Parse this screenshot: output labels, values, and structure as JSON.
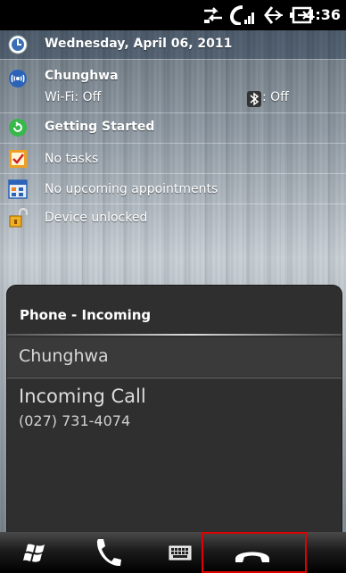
{
  "status_bar": {
    "time": "4:36",
    "icons": [
      "data-sync-icon",
      "signal-icon",
      "volume-icon",
      "battery-charging-icon"
    ]
  },
  "today": {
    "date": "Wednesday, April 06, 2011",
    "operator": "Chunghwa",
    "wifi": "Wi-Fi: Off",
    "bluetooth": ": Off",
    "getting_started": "Getting Started",
    "tasks": "No tasks",
    "appointments": "No upcoming appointments",
    "lock": "Device unlocked"
  },
  "incoming_panel": {
    "title": "Phone - Incoming",
    "caller": "Chunghwa",
    "call_label": "Incoming Call",
    "number": "(027) 731-4074"
  },
  "softbar": {
    "buttons": [
      "windows-start-icon",
      "phone-answer-icon",
      "keyboard-icon",
      "phone-hangup-icon"
    ],
    "highlight_color": "#e00000"
  }
}
